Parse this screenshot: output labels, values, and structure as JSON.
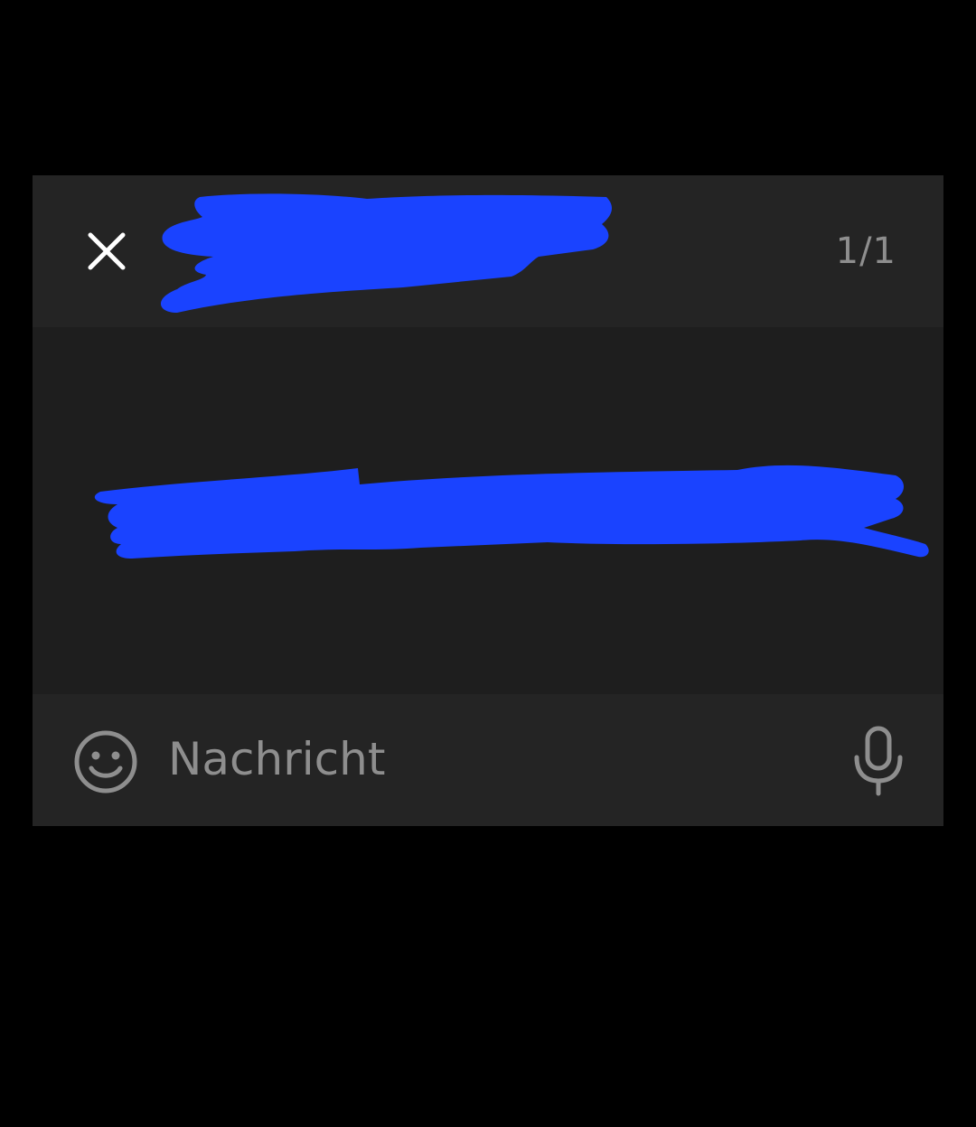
{
  "colors": {
    "page_background": "#000000",
    "card_background": "#1e1e1e",
    "bar_background": "#242424",
    "muted_text": "#8e8e8e",
    "redaction": "#1a43ff"
  },
  "header": {
    "close_icon": "close-icon",
    "counter": "1/1"
  },
  "composer": {
    "emoji_icon": "smiley-icon",
    "placeholder": "Nachricht",
    "mic_icon": "microphone-icon"
  }
}
